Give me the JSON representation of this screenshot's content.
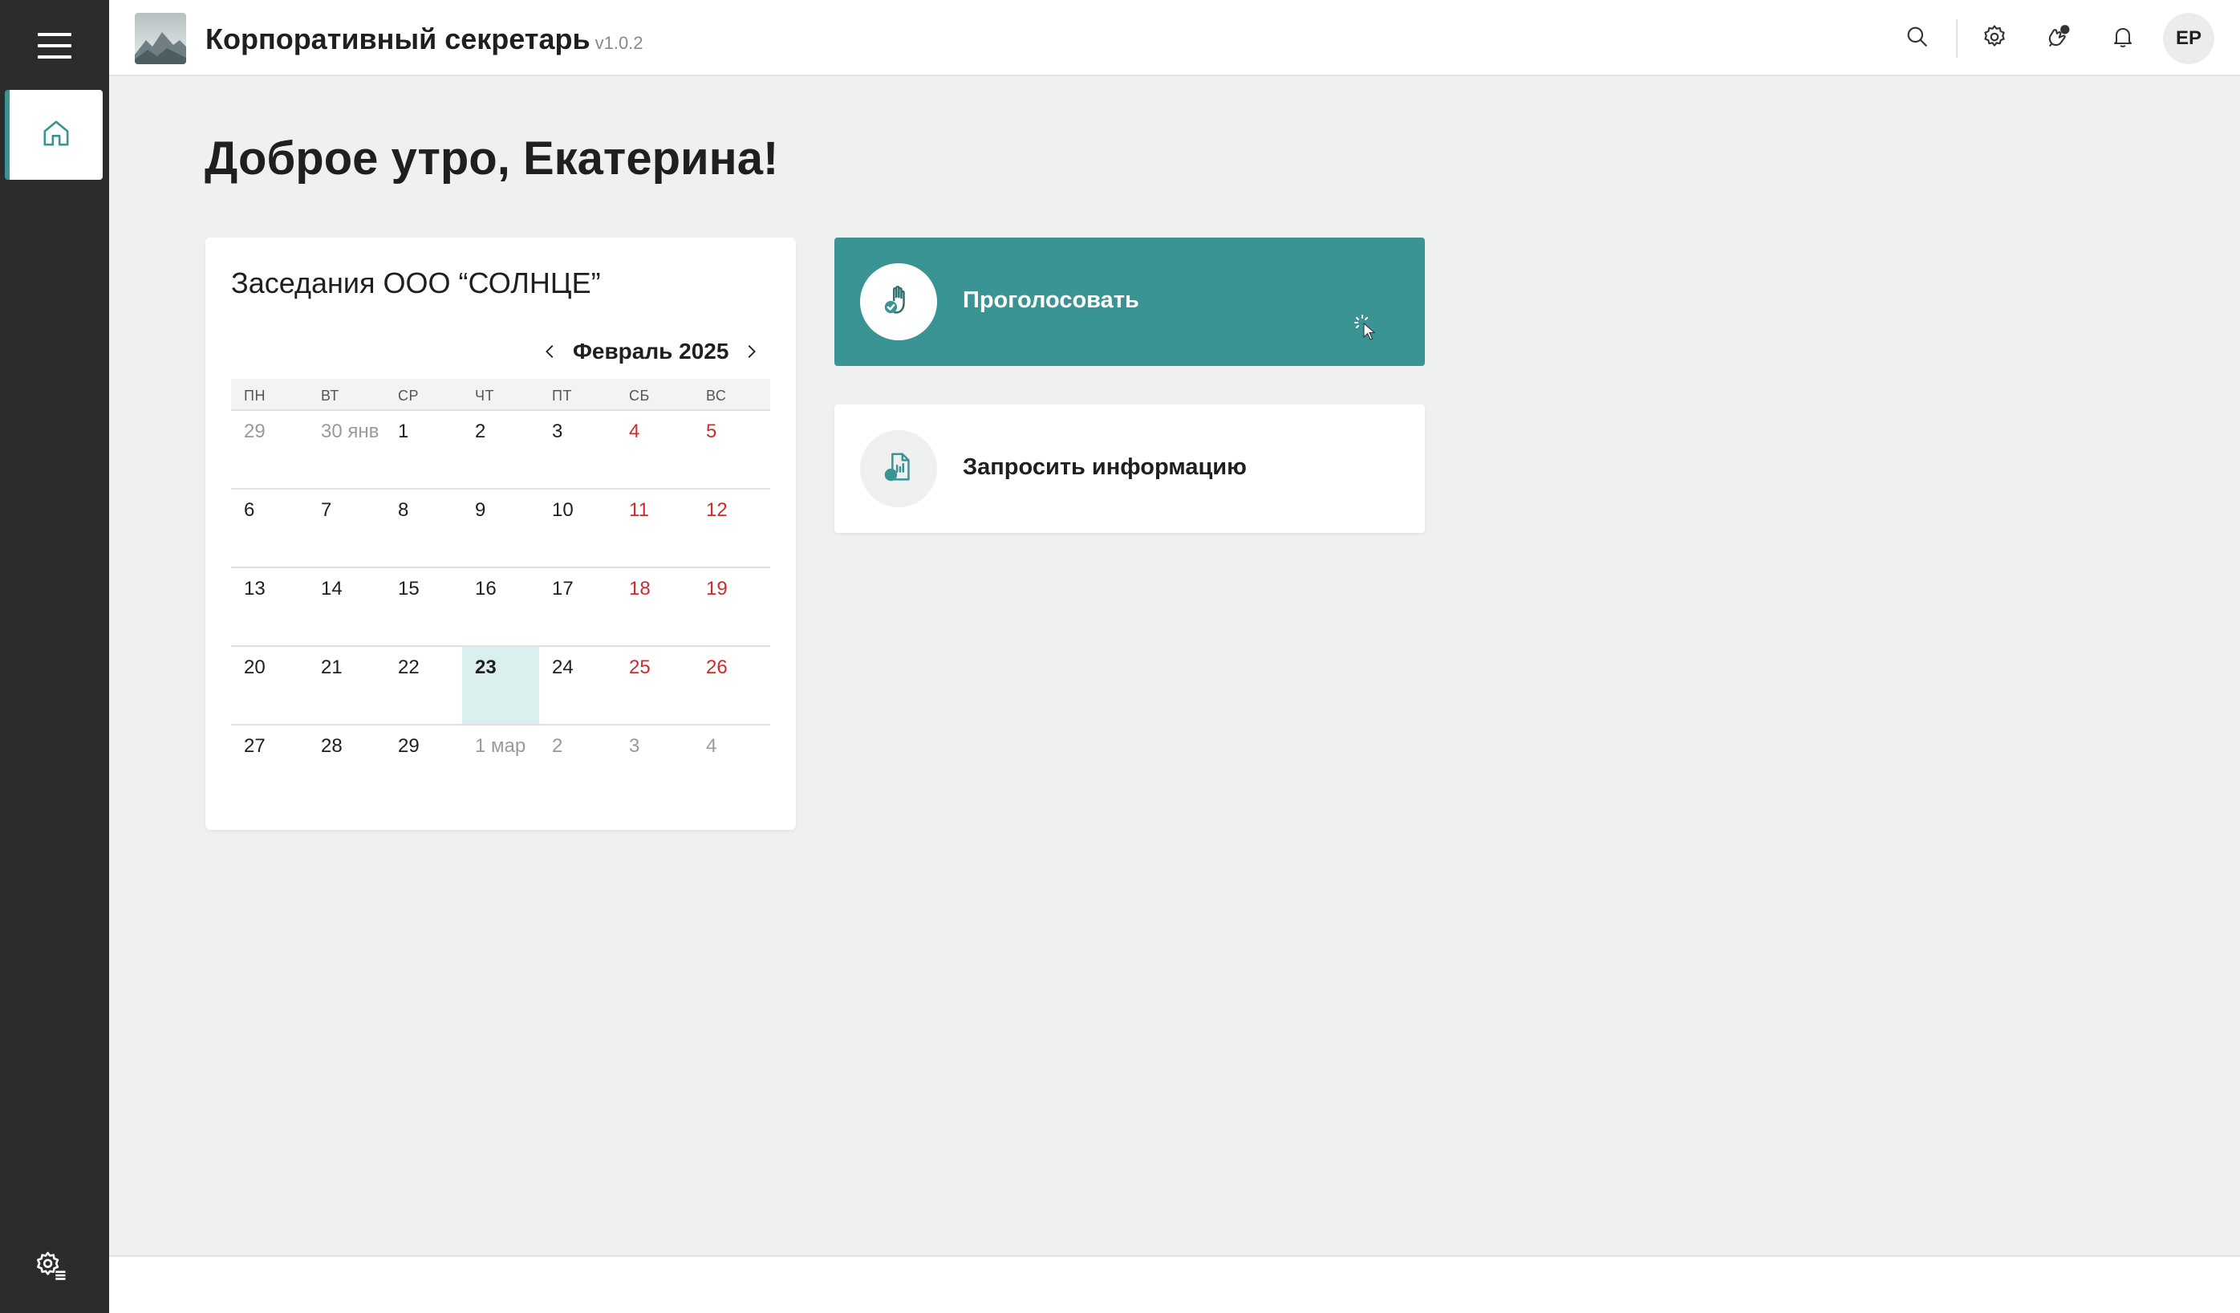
{
  "header": {
    "app_title": "Корпоративный секретарь",
    "app_version": "v1.0.2",
    "avatar_initials": "ЕР",
    "icons": [
      "search-icon",
      "gear-icon",
      "support-icon",
      "bell-icon"
    ]
  },
  "sidebar": {
    "items": [
      {
        "name": "home",
        "icon": "home-icon",
        "active": true
      }
    ],
    "bottom_icon": "settings-icon"
  },
  "greeting": "Доброе утро, Екатерина!",
  "calendar": {
    "title": "Заседания ООО “СОЛНЦЕ”",
    "month_label": "Февраль 2025",
    "day_names": [
      "пн",
      "вт",
      "ср",
      "чт",
      "пт",
      "сб",
      "вс"
    ],
    "weeks": [
      [
        "29",
        "30 янв",
        "1",
        "2",
        "3",
        "4",
        "5"
      ],
      [
        "6",
        "7",
        "8",
        "9",
        "10",
        "11",
        "12"
      ],
      [
        "13",
        "14",
        "15",
        "16",
        "17",
        "18",
        "19"
      ],
      [
        "20",
        "21",
        "22",
        "23",
        "24",
        "25",
        "26"
      ],
      [
        "27",
        "28",
        "29",
        "1 мар",
        "2",
        "3",
        "4"
      ]
    ],
    "selected_day": "23"
  },
  "actions": {
    "vote_label": "Проголосовать",
    "request_label": "Запросить информацию"
  },
  "colors": {
    "accent": "#3a9494",
    "sidebar_bg": "#2b2c2b",
    "weekend": "#d12a2a",
    "today_bg": "#dcefef",
    "page_bg": "#eff1f0"
  }
}
